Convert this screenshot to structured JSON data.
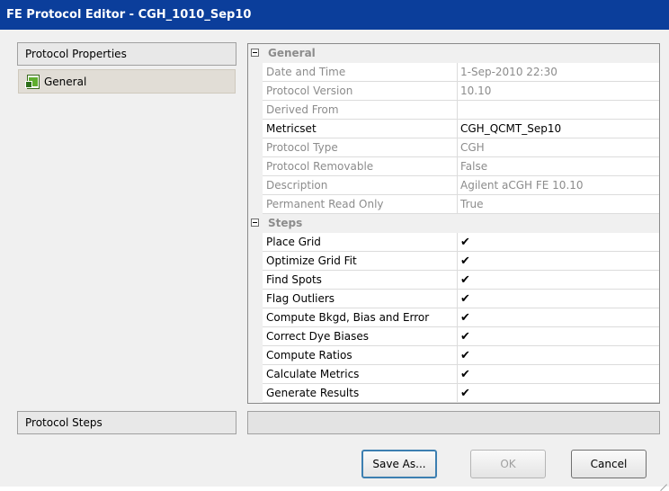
{
  "window": {
    "title": "FE Protocol Editor - CGH_1010_Sep10"
  },
  "left": {
    "properties_header": "Protocol Properties",
    "items": [
      {
        "label": "General",
        "icon": "document-icon"
      }
    ],
    "steps_header": "Protocol Steps"
  },
  "grid": {
    "general": {
      "label": "General",
      "rows": [
        {
          "name": "Date and Time",
          "value": "1-Sep-2010 22:30",
          "enabled": false
        },
        {
          "name": "Protocol Version",
          "value": "10.10",
          "enabled": false
        },
        {
          "name": "Derived From",
          "value": "",
          "enabled": false
        },
        {
          "name": "Metricset",
          "value": "CGH_QCMT_Sep10",
          "enabled": true
        },
        {
          "name": "Protocol Type",
          "value": "CGH",
          "enabled": false
        },
        {
          "name": "Protocol Removable",
          "value": "False",
          "enabled": false
        },
        {
          "name": "Description",
          "value": "Agilent aCGH FE 10.10",
          "enabled": false
        },
        {
          "name": "Permanent Read Only",
          "value": "True",
          "enabled": false
        }
      ]
    },
    "steps": {
      "label": "Steps",
      "rows": [
        {
          "name": "Place Grid",
          "value": "✔"
        },
        {
          "name": "Optimize Grid Fit",
          "value": "✔"
        },
        {
          "name": "Find Spots",
          "value": "✔"
        },
        {
          "name": "Flag Outliers",
          "value": "✔"
        },
        {
          "name": "Compute Bkgd, Bias and Error",
          "value": "✔"
        },
        {
          "name": "Correct Dye Biases",
          "value": "✔"
        },
        {
          "name": "Compute Ratios",
          "value": "✔"
        },
        {
          "name": "Calculate Metrics",
          "value": "✔"
        },
        {
          "name": "Generate Results",
          "value": "✔"
        }
      ]
    }
  },
  "buttons": {
    "save_as": "Save As...",
    "ok": "OK",
    "cancel": "Cancel"
  },
  "colors": {
    "titlebar": "#0b3e9b",
    "selected_item": "#e1ddd6",
    "disabled_text": "#8c8c8c"
  }
}
